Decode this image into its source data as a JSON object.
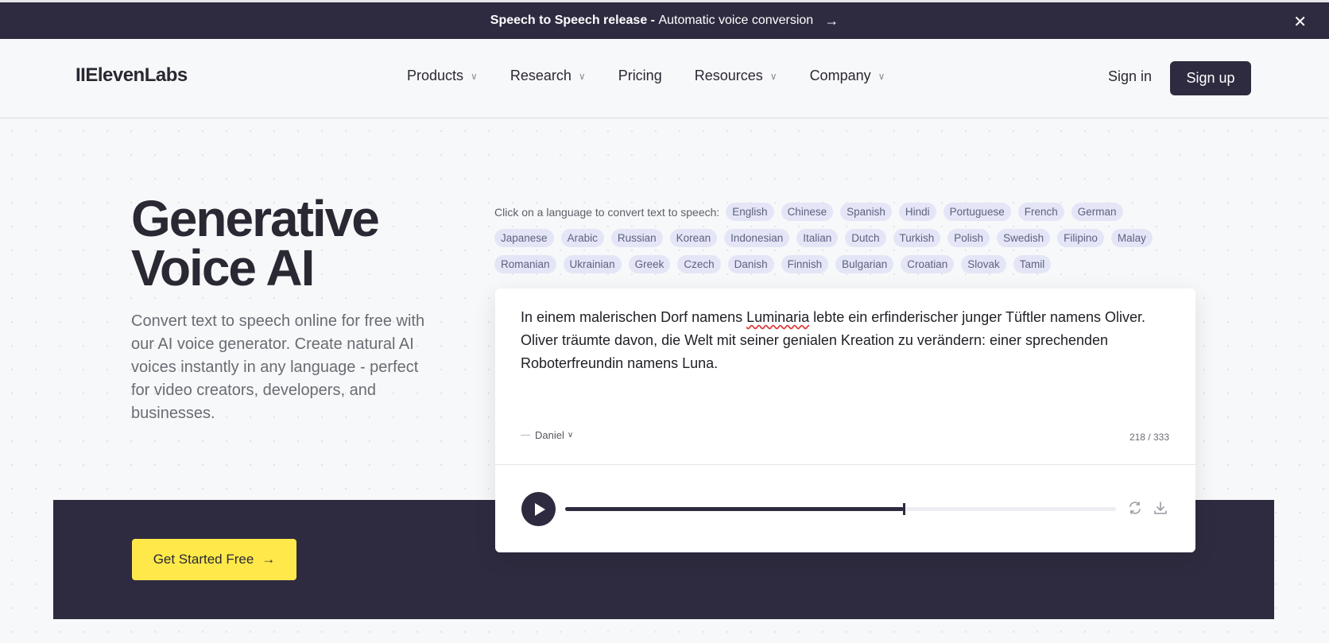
{
  "banner": {
    "bold": "Speech to Speech release - ",
    "text": "Automatic voice conversion",
    "arrow": "→",
    "close": "✕"
  },
  "nav": {
    "logo": "IIElevenLabs",
    "items": [
      {
        "label": "Products",
        "dropdown": true
      },
      {
        "label": "Research",
        "dropdown": true
      },
      {
        "label": "Pricing",
        "dropdown": false
      },
      {
        "label": "Resources",
        "dropdown": true
      },
      {
        "label": "Company",
        "dropdown": true
      }
    ],
    "signin": "Sign in",
    "signup": "Sign up"
  },
  "hero": {
    "title_line1": "Generative",
    "title_line2": "Voice AI",
    "description": "Convert text to speech online for free with our AI voice generator. Create natural AI voices instantly in any language - perfect for video creators, developers, and businesses.",
    "cta": "Get Started Free",
    "cta_arrow": "→"
  },
  "languages": {
    "prompt": "Click on a language to convert text to speech:",
    "rows": [
      [
        "English",
        "Chinese",
        "Spanish",
        "Hindi",
        "Portuguese",
        "French",
        "German"
      ],
      [
        "Japanese",
        "Arabic",
        "Russian",
        "Korean",
        "Indonesian",
        "Italian",
        "Dutch",
        "Turkish",
        "Polish",
        "Swedish",
        "Filipino",
        "Malay"
      ],
      [
        "Romanian",
        "Ukrainian",
        "Greek",
        "Czech",
        "Danish",
        "Finnish",
        "Bulgarian",
        "Croatian",
        "Slovak",
        "Tamil"
      ]
    ]
  },
  "editor": {
    "text_before": "In einem malerischen Dorf namens ",
    "text_misspelled": "Luminaria",
    "text_after": " lebte ein erfinderischer junger Tüftler namens Oliver. Oliver träumte davon, die Welt mit seiner genialen Kreation zu verändern: einer sprechenden Roboterfreundin namens Luna.",
    "voice": "Daniel",
    "char_count": "218 / 333"
  },
  "player": {
    "progress": 0.615,
    "icons": [
      "play-icon",
      "regenerate-icon",
      "download-icon"
    ]
  },
  "colors": {
    "dark": "#2e2b40",
    "accent_yellow": "#ffe94a",
    "chip_bg": "#e4e6f7",
    "background": "#f7f8f9"
  }
}
